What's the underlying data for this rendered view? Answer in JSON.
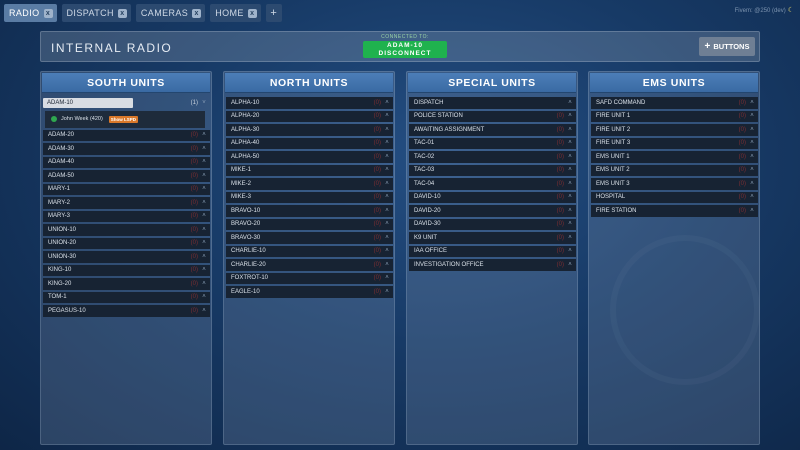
{
  "tabs": [
    {
      "label": "RADIO",
      "close": "x",
      "active": true
    },
    {
      "label": "DISPATCH",
      "close": "x",
      "active": false
    },
    {
      "label": "CAMERAS",
      "close": "x",
      "active": false
    },
    {
      "label": "HOME",
      "close": "x",
      "active": false
    }
  ],
  "add_tab": "+",
  "user_info": "Fivem: @250 (dev)",
  "header": {
    "title": "INTERNAL RADIO",
    "connected_to_label": "CONNECTED TO:",
    "connected_channel": "ADAM-10",
    "disconnect_label": "DISCONNECT",
    "buttons_label": "BUTTONS",
    "buttons_plus": "+"
  },
  "columns": [
    {
      "title": "SOUTH UNITS",
      "selected": {
        "label": "ADAM-10",
        "count": "(1)",
        "chevron": "˅"
      },
      "member": {
        "name": "John Week (420)",
        "badge": "Show LSPD"
      },
      "units": [
        {
          "label": "ADAM-20",
          "count": "(0)",
          "chevron": "˄"
        },
        {
          "label": "ADAM-30",
          "count": "(0)",
          "chevron": "˄"
        },
        {
          "label": "ADAM-40",
          "count": "(0)",
          "chevron": "˄"
        },
        {
          "label": "ADAM-50",
          "count": "(0)",
          "chevron": "˄"
        },
        {
          "label": "MARY-1",
          "count": "(0)",
          "chevron": "˄"
        },
        {
          "label": "MARY-2",
          "count": "(0)",
          "chevron": "˄"
        },
        {
          "label": "MARY-3",
          "count": "(0)",
          "chevron": "˄"
        },
        {
          "label": "UNION-10",
          "count": "(0)",
          "chevron": "˄"
        },
        {
          "label": "UNION-20",
          "count": "(0)",
          "chevron": "˄"
        },
        {
          "label": "UNION-30",
          "count": "(0)",
          "chevron": "˄"
        },
        {
          "label": "KING-10",
          "count": "(0)",
          "chevron": "˄"
        },
        {
          "label": "KING-20",
          "count": "(0)",
          "chevron": "˄"
        },
        {
          "label": "TOM-1",
          "count": "(0)",
          "chevron": "˄"
        },
        {
          "label": "PEGASUS-10",
          "count": "(0)",
          "chevron": "˄"
        }
      ]
    },
    {
      "title": "NORTH UNITS",
      "units": [
        {
          "label": "ALPHA-10",
          "count": "(0)",
          "chevron": "˄"
        },
        {
          "label": "ALPHA-20",
          "count": "(0)",
          "chevron": "˄"
        },
        {
          "label": "ALPHA-30",
          "count": "(0)",
          "chevron": "˄"
        },
        {
          "label": "ALPHA-40",
          "count": "(0)",
          "chevron": "˄"
        },
        {
          "label": "ALPHA-50",
          "count": "(0)",
          "chevron": "˄"
        },
        {
          "label": "MIKE-1",
          "count": "(0)",
          "chevron": "˄"
        },
        {
          "label": "MIKE-2",
          "count": "(0)",
          "chevron": "˄"
        },
        {
          "label": "MIKE-3",
          "count": "(0)",
          "chevron": "˄"
        },
        {
          "label": "BRAVO-10",
          "count": "(0)",
          "chevron": "˄"
        },
        {
          "label": "BRAVO-20",
          "count": "(0)",
          "chevron": "˄"
        },
        {
          "label": "BRAVO-30",
          "count": "(0)",
          "chevron": "˄"
        },
        {
          "label": "CHARLIE-10",
          "count": "(0)",
          "chevron": "˄"
        },
        {
          "label": "CHARLIE-20",
          "count": "(0)",
          "chevron": "˄"
        },
        {
          "label": "FOXTROT-10",
          "count": "(0)",
          "chevron": "˄"
        },
        {
          "label": "EAGLE-10",
          "count": "(0)",
          "chevron": "˄"
        }
      ]
    },
    {
      "title": "SPECIAL UNITS",
      "units": [
        {
          "label": "DISPATCH",
          "count": "",
          "chevron": "˄"
        },
        {
          "label": "POLICE STATION",
          "count": "(0)",
          "chevron": "˄"
        },
        {
          "label": "AWAITING ASSIGNMENT",
          "count": "(0)",
          "chevron": "˄"
        },
        {
          "label": "TAC-01",
          "count": "(0)",
          "chevron": "˄"
        },
        {
          "label": "TAC-02",
          "count": "(0)",
          "chevron": "˄"
        },
        {
          "label": "TAC-03",
          "count": "(0)",
          "chevron": "˄"
        },
        {
          "label": "TAC-04",
          "count": "(0)",
          "chevron": "˄"
        },
        {
          "label": "DAVID-10",
          "count": "(0)",
          "chevron": "˄"
        },
        {
          "label": "DAVID-20",
          "count": "(0)",
          "chevron": "˄"
        },
        {
          "label": "DAVID-30",
          "count": "(0)",
          "chevron": "˄"
        },
        {
          "label": "K9 UNIT",
          "count": "(0)",
          "chevron": "˄"
        },
        {
          "label": "IAA OFFICE",
          "count": "(0)",
          "chevron": "˄"
        },
        {
          "label": "INVESTIGATION OFFICE",
          "count": "(0)",
          "chevron": "˄"
        }
      ]
    },
    {
      "title": "EMS UNITS",
      "units": [
        {
          "label": "SAFD COMMAND",
          "count": "(0)",
          "chevron": "˄"
        },
        {
          "label": "FIRE UNIT 1",
          "count": "(0)",
          "chevron": "˄"
        },
        {
          "label": "FIRE UNIT 2",
          "count": "(0)",
          "chevron": "˄"
        },
        {
          "label": "FIRE UNIT 3",
          "count": "(0)",
          "chevron": "˄"
        },
        {
          "label": "EMS UNIT 1",
          "count": "(0)",
          "chevron": "˄"
        },
        {
          "label": "EMS UNIT 2",
          "count": "(0)",
          "chevron": "˄"
        },
        {
          "label": "EMS UNIT 3",
          "count": "(0)",
          "chevron": "˄"
        },
        {
          "label": "HOSPITAL",
          "count": "(0)",
          "chevron": "˄"
        },
        {
          "label": "FIRE STATION",
          "count": "(0)",
          "chevron": "˄"
        }
      ]
    }
  ],
  "colors": {
    "accent": "#4c7eb8",
    "connected_green": "#1fb24e",
    "badge_orange": "#d9782a",
    "row_bg": "#172333"
  }
}
